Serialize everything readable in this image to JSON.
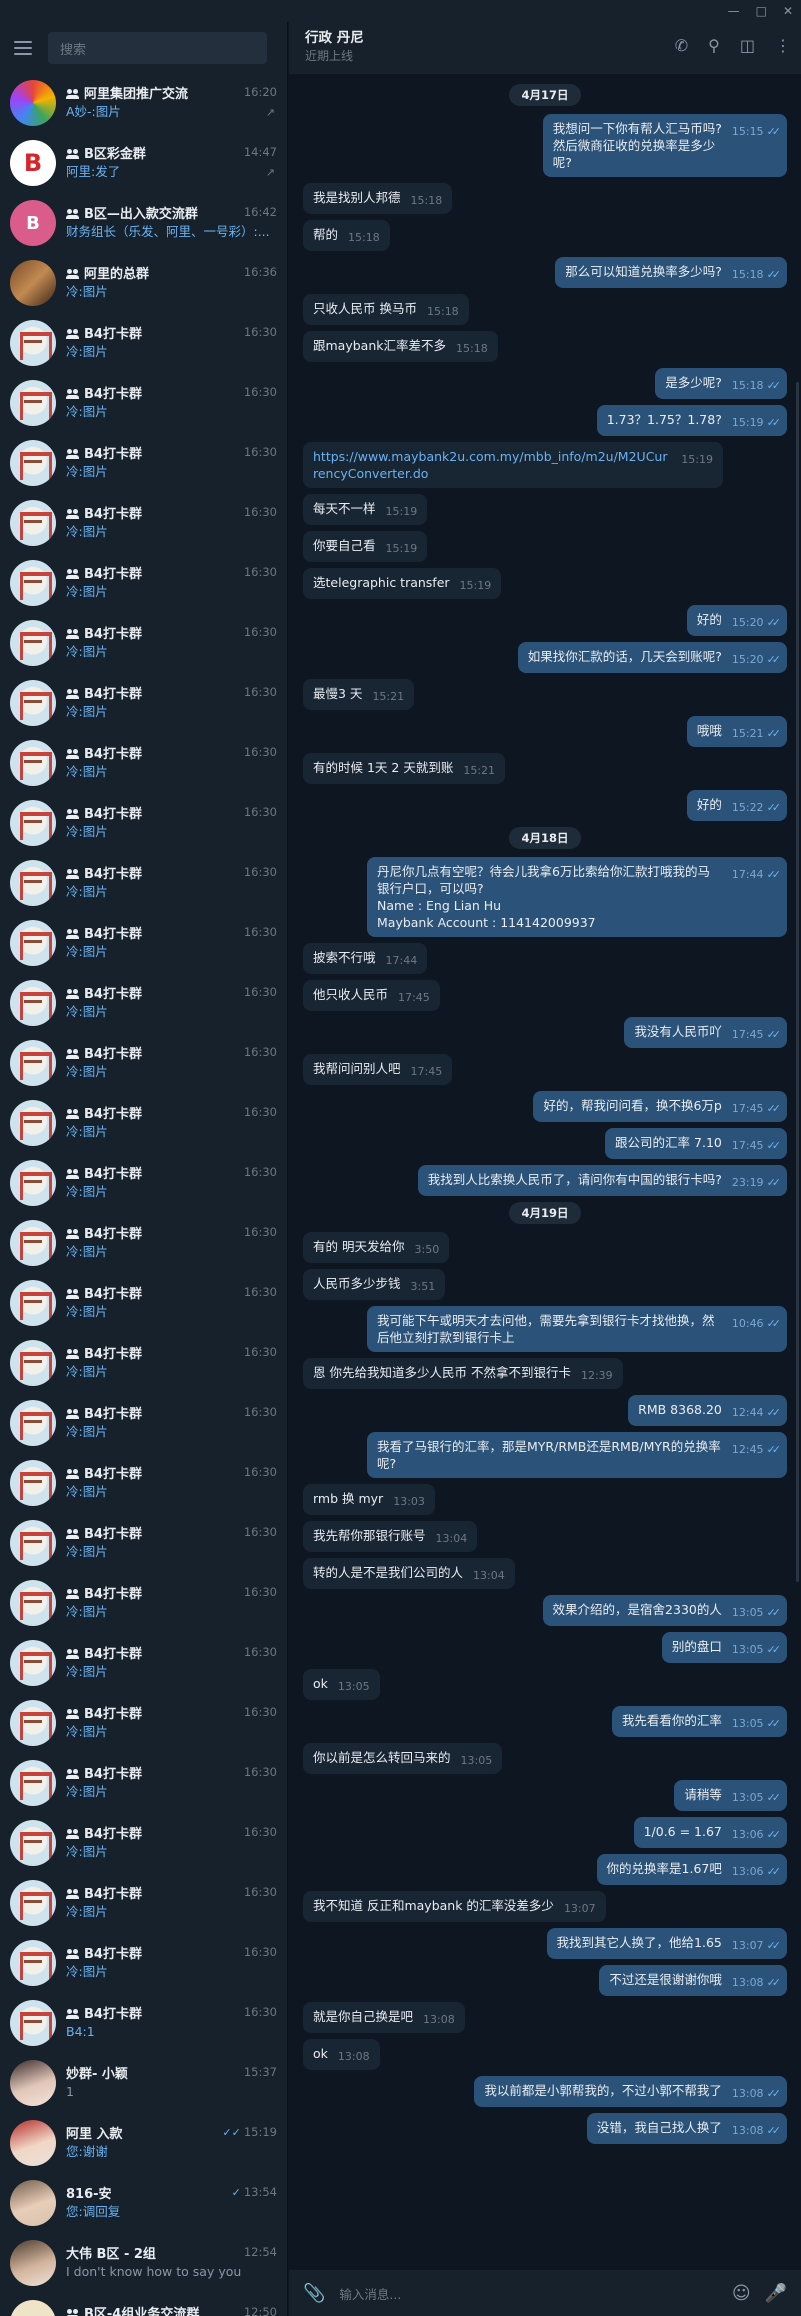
{
  "search": {
    "placeholder": "搜索"
  },
  "chats": [
    {
      "name": "阿里集团推广交流",
      "time": "16:20",
      "preview": "A妙-:图片",
      "group": true,
      "pinned": true,
      "avatar": "ring"
    },
    {
      "name": "B区彩金群",
      "time": "14:47",
      "preview": "阿里:发了",
      "group": true,
      "pinned": true,
      "avatar": "B-logo"
    },
    {
      "name": "B区—出入款交流群",
      "time": "16:42",
      "preview": "财务组长（乐发、阿里、一号彩）:...",
      "group": true,
      "avatar": "B"
    },
    {
      "name": "阿里的总群",
      "time": "16:36",
      "preview": "冷:图片",
      "group": true,
      "avatar": "photo"
    },
    {
      "name": "B4打卡群",
      "time": "16:30",
      "preview": "冷:图片",
      "group": true,
      "avatar": "b4"
    },
    {
      "name": "B4打卡群",
      "time": "16:30",
      "preview": "冷:图片",
      "group": true,
      "avatar": "b4"
    },
    {
      "name": "B4打卡群",
      "time": "16:30",
      "preview": "冷:图片",
      "group": true,
      "avatar": "b4"
    },
    {
      "name": "B4打卡群",
      "time": "16:30",
      "preview": "冷:图片",
      "group": true,
      "avatar": "b4"
    },
    {
      "name": "B4打卡群",
      "time": "16:30",
      "preview": "冷:图片",
      "group": true,
      "avatar": "b4"
    },
    {
      "name": "B4打卡群",
      "time": "16:30",
      "preview": "冷:图片",
      "group": true,
      "avatar": "b4"
    },
    {
      "name": "B4打卡群",
      "time": "16:30",
      "preview": "冷:图片",
      "group": true,
      "avatar": "b4"
    },
    {
      "name": "B4打卡群",
      "time": "16:30",
      "preview": "冷:图片",
      "group": true,
      "avatar": "b4"
    },
    {
      "name": "B4打卡群",
      "time": "16:30",
      "preview": "冷:图片",
      "group": true,
      "avatar": "b4"
    },
    {
      "name": "B4打卡群",
      "time": "16:30",
      "preview": "冷:图片",
      "group": true,
      "avatar": "b4"
    },
    {
      "name": "B4打卡群",
      "time": "16:30",
      "preview": "冷:图片",
      "group": true,
      "avatar": "b4"
    },
    {
      "name": "B4打卡群",
      "time": "16:30",
      "preview": "冷:图片",
      "group": true,
      "avatar": "b4"
    },
    {
      "name": "B4打卡群",
      "time": "16:30",
      "preview": "冷:图片",
      "group": true,
      "avatar": "b4"
    },
    {
      "name": "B4打卡群",
      "time": "16:30",
      "preview": "冷:图片",
      "group": true,
      "avatar": "b4"
    },
    {
      "name": "B4打卡群",
      "time": "16:30",
      "preview": "冷:图片",
      "group": true,
      "avatar": "b4"
    },
    {
      "name": "B4打卡群",
      "time": "16:30",
      "preview": "冷:图片",
      "group": true,
      "avatar": "b4"
    },
    {
      "name": "B4打卡群",
      "time": "16:30",
      "preview": "冷:图片",
      "group": true,
      "avatar": "b4"
    },
    {
      "name": "B4打卡群",
      "time": "16:30",
      "preview": "冷:图片",
      "group": true,
      "avatar": "b4"
    },
    {
      "name": "B4打卡群",
      "time": "16:30",
      "preview": "冷:图片",
      "group": true,
      "avatar": "b4"
    },
    {
      "name": "B4打卡群",
      "time": "16:30",
      "preview": "冷:图片",
      "group": true,
      "avatar": "b4"
    },
    {
      "name": "B4打卡群",
      "time": "16:30",
      "preview": "冷:图片",
      "group": true,
      "avatar": "b4"
    },
    {
      "name": "B4打卡群",
      "time": "16:30",
      "preview": "冷:图片",
      "group": true,
      "avatar": "b4"
    },
    {
      "name": "B4打卡群",
      "time": "16:30",
      "preview": "冷:图片",
      "group": true,
      "avatar": "b4"
    },
    {
      "name": "B4打卡群",
      "time": "16:30",
      "preview": "冷:图片",
      "group": true,
      "avatar": "b4"
    },
    {
      "name": "B4打卡群",
      "time": "16:30",
      "preview": "冷:图片",
      "group": true,
      "avatar": "b4"
    },
    {
      "name": "B4打卡群",
      "time": "16:30",
      "preview": "冷:图片",
      "group": true,
      "avatar": "b4"
    },
    {
      "name": "B4打卡群",
      "time": "16:30",
      "preview": "冷:图片",
      "group": true,
      "avatar": "b4"
    },
    {
      "name": "B4打卡群",
      "time": "16:30",
      "preview": "冷:图片",
      "group": true,
      "avatar": "b4"
    },
    {
      "name": "B4打卡群",
      "time": "16:30",
      "preview": "B4:1",
      "group": true,
      "avatar": "b4"
    },
    {
      "name": "妙群- 小颖",
      "time": "15:37",
      "preview": "1",
      "group": false,
      "avatar": "girl",
      "grey": true
    },
    {
      "name": "阿里 入款",
      "time": "15:19",
      "preview": "您:谢谢",
      "group": false,
      "avatar": "girl2",
      "ticks": "✓✓"
    },
    {
      "name": "816-安",
      "time": "13:54",
      "preview": "您:调回复",
      "group": false,
      "avatar": "girl3",
      "ticks": "✓"
    },
    {
      "name": "大伟 B区 - 2组",
      "time": "12:54",
      "preview": "I don't know how to say you",
      "group": false,
      "avatar": "girl4",
      "grey": true
    },
    {
      "name": "B区-4组业务交流群",
      "time": "12:50",
      "preview": "",
      "group": true,
      "avatar": "坚持"
    }
  ],
  "header": {
    "title": "行政 丹尼",
    "status": "近期上线"
  },
  "compose": {
    "placeholder": "输入消息..."
  },
  "messages": [
    {
      "type": "date",
      "text": "4月17日"
    },
    {
      "dir": "out",
      "text": "我想问一下你有帮人汇马币吗?\n然后微商征收的兑换率是多少呢?",
      "time": "15:15",
      "read": true
    },
    {
      "dir": "in",
      "text": "我是找别人邦德",
      "time": "15:18"
    },
    {
      "dir": "in",
      "text": "帮的",
      "time": "15:18"
    },
    {
      "dir": "out",
      "text": "那么可以知道兑换率多少吗?",
      "time": "15:18",
      "read": true
    },
    {
      "dir": "in",
      "text": "只收人民币 换马币",
      "time": "15:18"
    },
    {
      "dir": "in",
      "text": "跟maybank汇率差不多",
      "time": "15:18"
    },
    {
      "dir": "out",
      "text": "是多少呢?",
      "time": "15:18",
      "read": true
    },
    {
      "dir": "out",
      "text": "1.73？1.75？1.78?",
      "time": "15:19",
      "read": true
    },
    {
      "dir": "in",
      "text": "https://www.maybank2u.com.my/mbb_info/m2u/M2UCurrencyConverter.do",
      "time": "15:19",
      "link": true
    },
    {
      "dir": "in",
      "text": "每天不一样",
      "time": "15:19"
    },
    {
      "dir": "in",
      "text": "你要自己看",
      "time": "15:19"
    },
    {
      "dir": "in",
      "text": "选telegraphic transfer",
      "time": "15:19"
    },
    {
      "dir": "out",
      "text": "好的",
      "time": "15:20",
      "read": true
    },
    {
      "dir": "out",
      "text": "如果找你汇款的话，几天会到账呢?",
      "time": "15:20",
      "read": true
    },
    {
      "dir": "in",
      "text": "最慢3 天",
      "time": "15:21"
    },
    {
      "dir": "out",
      "text": "哦哦",
      "time": "15:21",
      "read": true
    },
    {
      "dir": "in",
      "text": "有的时候 1天 2 天就到账",
      "time": "15:21"
    },
    {
      "dir": "out",
      "text": "好的",
      "time": "15:22",
      "read": true
    },
    {
      "type": "date",
      "text": "4月18日"
    },
    {
      "dir": "out",
      "text": "丹尼你几点有空呢？待会儿我拿6万比索给你汇款打哦我的马银行户口，可以吗?\nName : Eng Lian Hu\nMaybank Account : 114142009937",
      "time": "17:44",
      "read": true
    },
    {
      "dir": "in",
      "text": "披索不行哦",
      "time": "17:44"
    },
    {
      "dir": "in",
      "text": "他只收人民币",
      "time": "17:45"
    },
    {
      "dir": "out",
      "text": "我没有人民币吖",
      "time": "17:45",
      "read": true
    },
    {
      "dir": "in",
      "text": "我帮问问别人吧",
      "time": "17:45"
    },
    {
      "dir": "out",
      "text": "好的，帮我问问看，换不换6万p",
      "time": "17:45",
      "read": true
    },
    {
      "dir": "out",
      "text": "跟公司的汇率 7.10",
      "time": "17:45",
      "read": true
    },
    {
      "dir": "out",
      "text": "我找到人比索换人民币了，请问你有中国的银行卡吗?",
      "time": "23:19",
      "read": true
    },
    {
      "type": "date",
      "text": "4月19日"
    },
    {
      "dir": "in",
      "text": "有的 明天发给你",
      "time": "3:50"
    },
    {
      "dir": "in",
      "text": "人民币多少步钱",
      "time": "3:51"
    },
    {
      "dir": "out",
      "text": "我可能下午或明天才去问他，需要先拿到银行卡才找他换，然后他立刻打款到银行卡上",
      "time": "10:46",
      "read": true
    },
    {
      "dir": "in",
      "text": "恩 你先给我知道多少人民币 不然拿不到银行卡",
      "time": "12:39"
    },
    {
      "dir": "out",
      "text": "RMB 8368.20",
      "time": "12:44",
      "read": true
    },
    {
      "dir": "out",
      "text": "我看了马银行的汇率，那是MYR/RMB还是RMB/MYR的兑换率呢?",
      "time": "12:45",
      "read": true
    },
    {
      "dir": "in",
      "text": "rmb 换 myr",
      "time": "13:03"
    },
    {
      "dir": "in",
      "text": "我先帮你那银行账号",
      "time": "13:04"
    },
    {
      "dir": "in",
      "text": "转的人是不是我们公司的人",
      "time": "13:04"
    },
    {
      "dir": "out",
      "text": "效果介绍的，是宿舍2330的人",
      "time": "13:05",
      "read": true
    },
    {
      "dir": "out",
      "text": "别的盘口",
      "time": "13:05",
      "read": true
    },
    {
      "dir": "in",
      "text": "ok",
      "time": "13:05"
    },
    {
      "dir": "out",
      "text": "我先看看你的汇率",
      "time": "13:05",
      "read": true
    },
    {
      "dir": "in",
      "text": "你以前是怎么转回马来的",
      "time": "13:05"
    },
    {
      "dir": "out",
      "text": "请稍等",
      "time": "13:05",
      "read": true
    },
    {
      "dir": "out",
      "text": "1/0.6 = 1.67",
      "time": "13:06",
      "read": true
    },
    {
      "dir": "out",
      "text": "你的兑换率是1.67吧",
      "time": "13:06",
      "read": true
    },
    {
      "dir": "in",
      "text": "我不知道 反正和maybank 的汇率没差多少",
      "time": "13:07"
    },
    {
      "dir": "out",
      "text": "我找到其它人换了，他给1.65",
      "time": "13:07",
      "read": true
    },
    {
      "dir": "out",
      "text": "不过还是很谢谢你哦",
      "time": "13:08",
      "read": true
    },
    {
      "dir": "in",
      "text": "就是你自己换是吧",
      "time": "13:08"
    },
    {
      "dir": "in",
      "text": "ok",
      "time": "13:08"
    },
    {
      "dir": "out",
      "text": "我以前都是小郭帮我的，不过小郭不帮我了",
      "time": "13:08",
      "read": true
    },
    {
      "dir": "out",
      "text": "没错，我自己找人换了",
      "time": "13:08",
      "read": true
    }
  ],
  "colors": {
    "bg": "#0e1621",
    "panel": "#17212b",
    "out": "#2b5278",
    "in": "#182533",
    "accent": "#6ab2f2"
  }
}
